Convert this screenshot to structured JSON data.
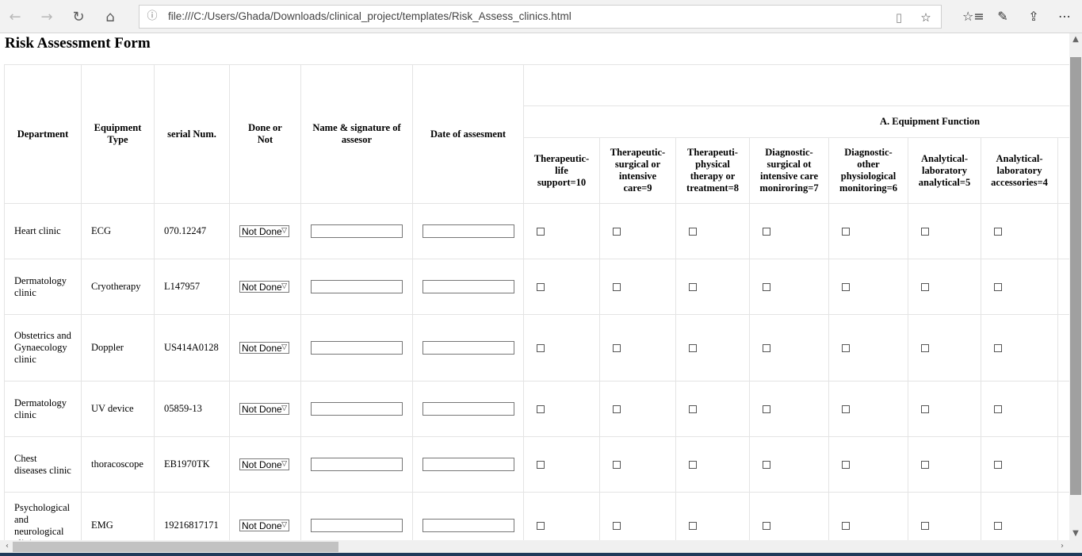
{
  "browser": {
    "url": "file:///C:/Users/Ghada/Downloads/clinical_project/templates/Risk_Assess_clinics.html",
    "back_icon": "←",
    "forward_icon": "→",
    "refresh_icon": "↻",
    "home_icon": "⌂",
    "info_icon": "ⓘ",
    "reading_icon": "▯",
    "star_icon": "☆",
    "favorites_icon": "☆≡",
    "notes_icon": "✎",
    "share_icon": "⇪",
    "more_icon": "⋯"
  },
  "page": {
    "title": "Risk Assessment Form"
  },
  "table": {
    "headers": {
      "department": "Department",
      "equipment_type": "Equipment Type",
      "serial": "serial Num.",
      "done": "Done or Not",
      "assessor": "Name & signature of assesor",
      "date": "Date of assesment",
      "group": "A. Equipment Function",
      "functions": [
        "Therapeutic-life support=10",
        "Therapeutic-surgical or intensive care=9",
        "Therapeuti-physical therapy or treatment=8",
        "Diagnostic-surgical ot intensive care moniroring=7",
        "Diagnostic-other physiological monitoring=6",
        "Analytical-laboratory analytical=5",
        "Analytical-laboratory accessories=4"
      ]
    },
    "rows": [
      {
        "department": "Heart clinic",
        "equipment": "ECG",
        "serial": "070.12247",
        "status": "Not Done"
      },
      {
        "department": "Dermatology clinic",
        "equipment": "Cryotherapy",
        "serial": "L147957",
        "status": "Not Done"
      },
      {
        "department": "Obstetrics and Gynaecology clinic",
        "equipment": "Doppler",
        "serial": "US414A0128",
        "status": "Not Done"
      },
      {
        "department": "Dermatology clinic",
        "equipment": "UV device",
        "serial": "05859-13",
        "status": "Not Done"
      },
      {
        "department": "Chest diseases clinic",
        "equipment": "thoracoscope",
        "serial": "EB1970TK",
        "status": "Not Done"
      },
      {
        "department": "Psychological and neurological clinic",
        "equipment": "EMG",
        "serial": "19216817171",
        "status": "Not Done"
      }
    ],
    "select_arrow": "▽",
    "checkbox_checked": false
  },
  "scroll": {
    "up": "▲",
    "down": "▼",
    "left": "‹",
    "right": "›"
  }
}
